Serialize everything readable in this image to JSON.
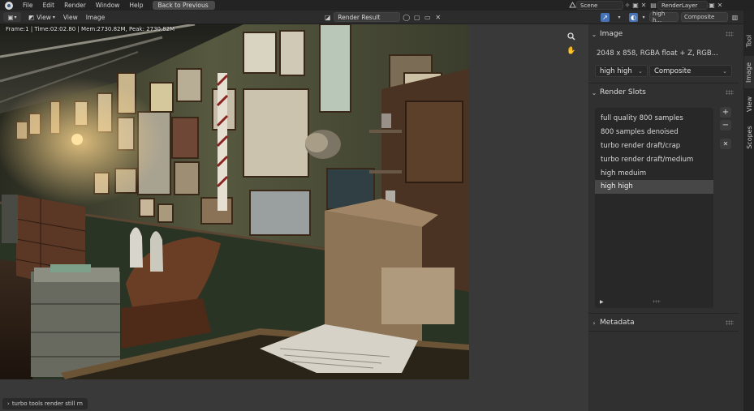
{
  "menubar": {
    "menus": [
      "File",
      "Edit",
      "Render",
      "Window",
      "Help"
    ],
    "back_button": "Back to Previous",
    "scene": "Scene",
    "view_layer": "RenderLayer"
  },
  "header": {
    "view_menu": "View",
    "view_menu2": "View",
    "image_menu": "Image",
    "image_name": "Render Result",
    "slot_dropdown": "high h...",
    "layer_dropdown": "Composite"
  },
  "viewport": {
    "info": "Frame:1 | Time:02:02.80 | Mem:2730.82M, Peak: 2730.82M",
    "status": "turbo tools render still rn"
  },
  "sidebar": {
    "image_panel": {
      "title": "Image",
      "info": "2048 x 858,  RGBA float + Z,  RGB...",
      "slot_value": "high high",
      "layer_value": "Composite"
    },
    "render_slots_panel": {
      "title": "Render Slots",
      "slots": [
        "full quality 800 samples",
        "800 samples denoised",
        "turbo render draft/crap",
        "turbo render draft/medium",
        "high meduim",
        "high high"
      ],
      "active_index": 5
    },
    "metadata_panel": {
      "title": "Metadata"
    }
  },
  "tabs": [
    "Tool",
    "Image",
    "View",
    "Scopes"
  ],
  "active_tab": "Image",
  "colors": {
    "accent_blue": "#4772b3",
    "panel_bg": "#303030",
    "list_bg": "#282828",
    "active_row": "#474747"
  }
}
